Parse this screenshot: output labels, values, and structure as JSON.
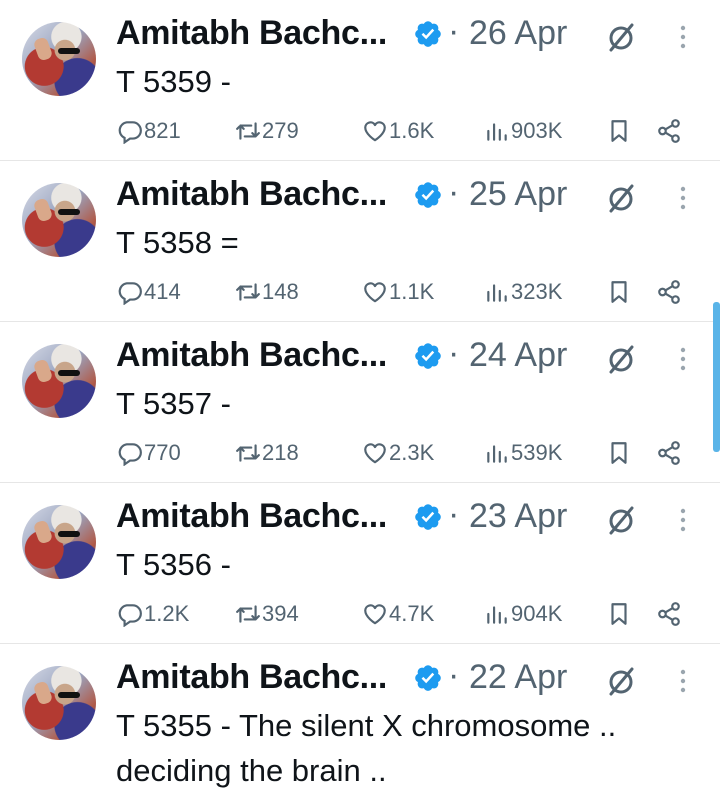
{
  "colors": {
    "verified": "#1d9bf0",
    "muted": "#536471",
    "text": "#0f1419",
    "scrollbar": "#5ab4e8"
  },
  "tweets": [
    {
      "name": "Amitabh Bachc...",
      "dot": "·",
      "date": "26 Apr",
      "text": "T 5359 -",
      "replies": "821",
      "retweets": "279",
      "likes": "1.6K",
      "views": "903K"
    },
    {
      "name": "Amitabh Bachc...",
      "dot": "·",
      "date": "25 Apr",
      "text": "T 5358 =",
      "replies": "414",
      "retweets": "148",
      "likes": "1.1K",
      "views": "323K"
    },
    {
      "name": "Amitabh Bachc...",
      "dot": "·",
      "date": "24 Apr",
      "text": "T 5357 -",
      "replies": "770",
      "retweets": "218",
      "likes": "2.3K",
      "views": "539K"
    },
    {
      "name": "Amitabh Bachc...",
      "dot": "·",
      "date": "23 Apr",
      "text": "T 5356 -",
      "replies": "1.2K",
      "retweets": "394",
      "likes": "4.7K",
      "views": "904K"
    },
    {
      "name": "Amitabh Bachc...",
      "dot": "·",
      "date": "22 Apr",
      "text": "T 5355 - The silent X chromosome .. deciding the brain ..",
      "replies": null,
      "retweets": null,
      "likes": null,
      "views": null
    }
  ]
}
